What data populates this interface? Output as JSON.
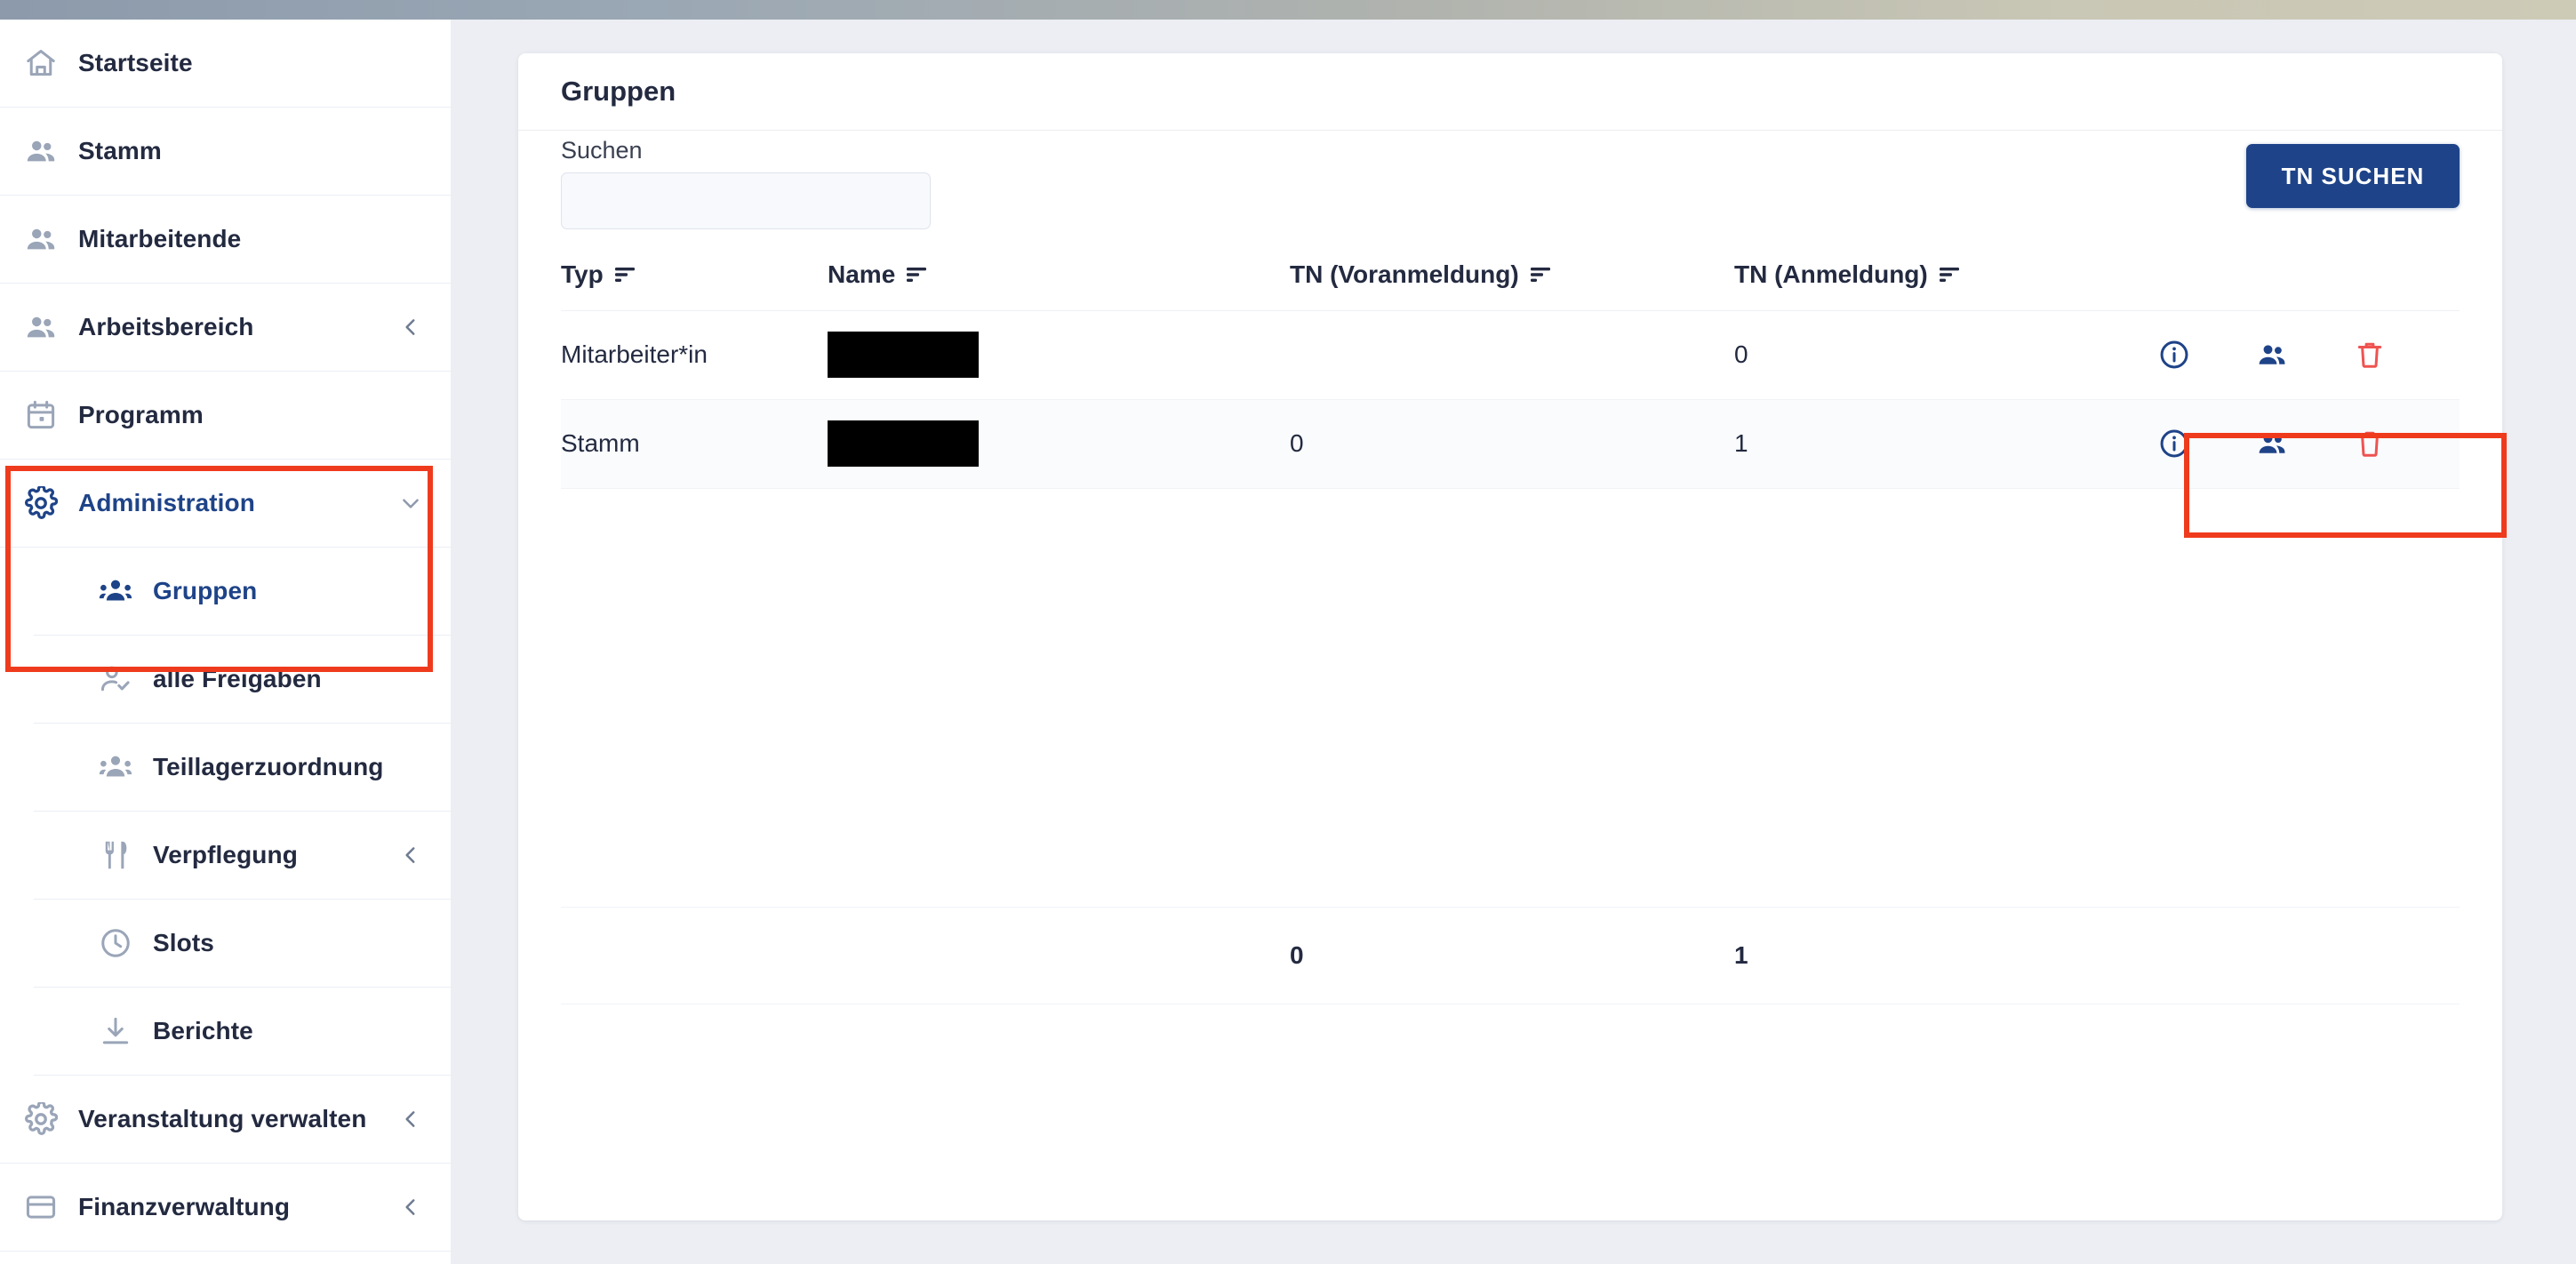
{
  "theme": {
    "accent_navy": "#1e4388",
    "annotation_red": "#ef3b1d",
    "delete_red": "#ef5350",
    "text_dark": "#232a40",
    "muted_icon": "#9aa5b8",
    "page_bg": "#eceef3"
  },
  "sidebar": {
    "items": [
      {
        "label": "Startseite",
        "icon": "home-icon",
        "level": "top",
        "chevron": "",
        "active": false
      },
      {
        "label": "Stamm",
        "icon": "people-icon",
        "level": "top",
        "chevron": "",
        "active": false
      },
      {
        "label": "Mitarbeitende",
        "icon": "people-icon",
        "level": "top",
        "chevron": "",
        "active": false
      },
      {
        "label": "Arbeitsbereich",
        "icon": "people-icon",
        "level": "top",
        "chevron": "left",
        "active": false
      },
      {
        "label": "Programm",
        "icon": "calendar-icon",
        "level": "top",
        "chevron": "",
        "active": false
      },
      {
        "label": "Administration",
        "icon": "gear-icon",
        "level": "top",
        "chevron": "down",
        "active": true
      },
      {
        "label": "Gruppen",
        "icon": "group-icon",
        "level": "sub",
        "chevron": "",
        "active": true
      },
      {
        "label": "alle Freigaben",
        "icon": "person-check-icon",
        "level": "sub",
        "chevron": "",
        "active": false
      },
      {
        "label": "Teillagerzuordnung",
        "icon": "group-icon",
        "level": "sub",
        "chevron": "",
        "active": false
      },
      {
        "label": "Verpflegung",
        "icon": "cutlery-icon",
        "level": "sub",
        "chevron": "left",
        "active": false
      },
      {
        "label": "Slots",
        "icon": "clock-icon",
        "level": "sub",
        "chevron": "",
        "active": false
      },
      {
        "label": "Berichte",
        "icon": "download-icon",
        "level": "sub",
        "chevron": "",
        "active": false
      },
      {
        "label": "Veranstaltung verwalten",
        "icon": "gear-icon",
        "level": "top",
        "chevron": "left",
        "active": false
      },
      {
        "label": "Finanzverwaltung",
        "icon": "card-icon",
        "level": "top",
        "chevron": "left",
        "active": false
      }
    ]
  },
  "card": {
    "title": "Gruppen",
    "search": {
      "label": "Suchen",
      "value": "",
      "placeholder": ""
    },
    "tn_suchen_button": "TN SUCHEN"
  },
  "table": {
    "columns": [
      {
        "key": "typ",
        "label": "Typ",
        "sortable": true
      },
      {
        "key": "name",
        "label": "Name",
        "sortable": true
      },
      {
        "key": "vor",
        "label": "TN (Voranmeldung)",
        "sortable": true
      },
      {
        "key": "anm",
        "label": "TN (Anmeldung)",
        "sortable": true
      },
      {
        "key": "act",
        "label": "",
        "sortable": false
      }
    ],
    "rows": [
      {
        "typ": "Mitarbeiter*in",
        "name": "",
        "name_redacted": true,
        "vor": "",
        "anm": "0"
      },
      {
        "typ": "Stamm",
        "name": "",
        "name_redacted": true,
        "vor": "0",
        "anm": "1"
      }
    ],
    "totals": {
      "typ": "",
      "name": "",
      "vor": "0",
      "anm": "1"
    },
    "row_actions": [
      {
        "name": "info-icon",
        "title": "Info"
      },
      {
        "name": "people-icon",
        "title": "Teilnehmende"
      },
      {
        "name": "trash-icon",
        "title": "Löschen"
      }
    ]
  }
}
